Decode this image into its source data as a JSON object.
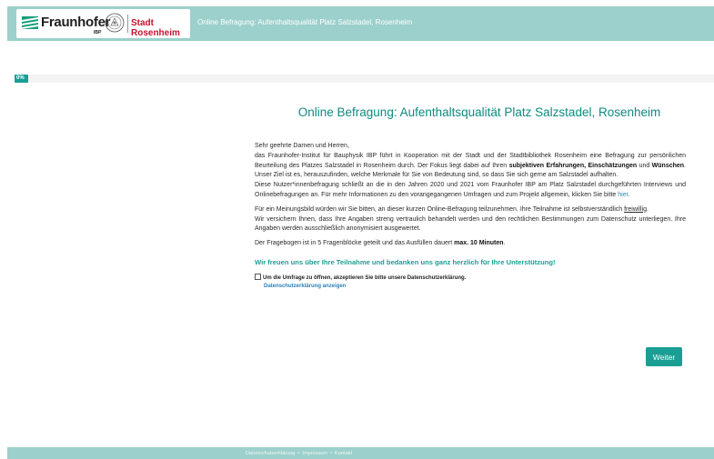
{
  "header": {
    "logo_name": "Fraunhofer",
    "logo_sub": "IBP",
    "city": "Stadt Rosenheim",
    "title": "Online Befragung: Aufenthaltsqualität Platz Salzstadel, Rosenheim"
  },
  "progress": {
    "label": "0%",
    "percent": 0
  },
  "main": {
    "title": "Online Befragung: Aufenthaltsqualität Platz Salzstadel, Rosenheim",
    "greeting": "Sehr geehrte Damen und Herren,",
    "p1_a": "das Fraunhofer-Institut für Bauphysik IBP führt in Kooperation mit der Stadt und der Stadtbibliothek Rosenheim eine Befragung zur persönlichen Beurteilung des Platzes Salzstadel in Rosenheim durch. Der Fokus liegt dabei auf Ihren ",
    "p1_b1": "subjektiven Erfahrungen",
    "p1_comma": ", ",
    "p1_b2": "Einschätzungen",
    "p1_und": " und ",
    "p1_b3": "Wünschen",
    "p1_c": ". Unser Ziel ist es, herauszufinden, welche Merkmale für Sie von Bedeutung sind, so dass Sie sich gerne am Salzstadel aufhalten.",
    "p2_a": "Diese Nutzer*innenbefragung schließt an die in den Jahren 2020 und 2021 vom Fraunhofer IBP am Platz Salzstadel durchgeführten Interviews und Onlinebefragungen an. Für mehr Informationen zu den vorangegangenen Umfragen und zum Projekt allgemein, klicken Sie bitte ",
    "p2_link": "hier",
    "p2_end": ".",
    "p3_a": "Für ein Meinungsbild würden wir Sie bitten, an dieser kurzen Online-Befragung teilzunehmen. Ihre Teilnahme ist selbstverständlich ",
    "p3_u": "freiwillig",
    "p3_end": ".",
    "p4": "Wir versichern Ihnen, dass Ihre Angaben streng vertraulich behandelt werden und den rechtlichen Bestimmungen zum Datenschutz unterliegen. Ihre Angaben werden ausschließlich anonymisiert ausgewertet.",
    "p5_a": "Der Fragebogen ist in 5 Fragenblöcke geteilt und das Ausfüllen dauert ",
    "p5_b": "max. 10 Minuten",
    "p5_end": ".",
    "thanks": "Wir freuen uns über Ihre Teilnahme und bedanken uns ganz herzlich für Ihre Unterstützung!",
    "consent_label": "Um die Umfrage zu öffnen, akzeptieren Sie bitte unsere Datenschutzerklärung.",
    "consent_link": "Datenschutzerklärung anzeigen",
    "next_button": "Weiter"
  },
  "footer": {
    "link1": "Datenschutzerklärung",
    "link2": "Impressum",
    "link3": "Kontakt",
    "separator": "•"
  },
  "colors": {
    "teal": "#1a9e94",
    "header_bg": "#9cd0cc",
    "city_red": "#c8102e"
  }
}
